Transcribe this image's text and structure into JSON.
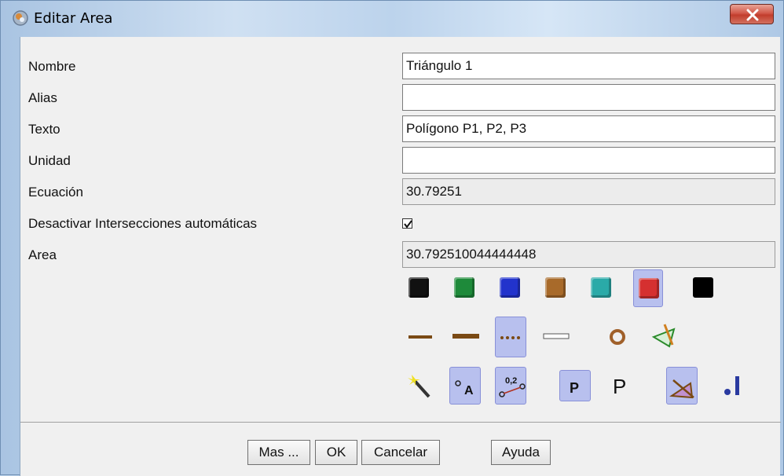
{
  "window": {
    "title": "Editar Area"
  },
  "form": {
    "rows": [
      {
        "label": "Nombre",
        "value": "Triángulo 1"
      },
      {
        "label": "Alias",
        "value": ""
      },
      {
        "label": "Texto",
        "value": "Polígono P1, P2, P3"
      },
      {
        "label": "Unidad",
        "value": ""
      },
      {
        "label": "Ecuación",
        "value": "30.79251"
      },
      {
        "label": "Desactivar Intersecciones automáticas",
        "checked": true
      },
      {
        "label": "Area",
        "value": "30.792510044444448"
      }
    ]
  },
  "palette": {
    "colors": [
      "#111111",
      "#1e8a3a",
      "#2233cc",
      "#a86a2a",
      "#2aaaa8",
      "#d53030",
      "#000000"
    ],
    "selected_color": "#d53030"
  },
  "buttons": {
    "mas": "Mas ...",
    "ok": "OK",
    "cancelar": "Cancelar",
    "ayuda": "Ayuda"
  },
  "icons": [
    "minimize-icon",
    "close-icon",
    "checkmark-icon",
    "magic-wand-icon",
    "point-label-icon",
    "coordinate-label-icon",
    "bold-p-icon",
    "plain-p-icon",
    "filled-triangle-icon",
    "point-line-icon"
  ]
}
